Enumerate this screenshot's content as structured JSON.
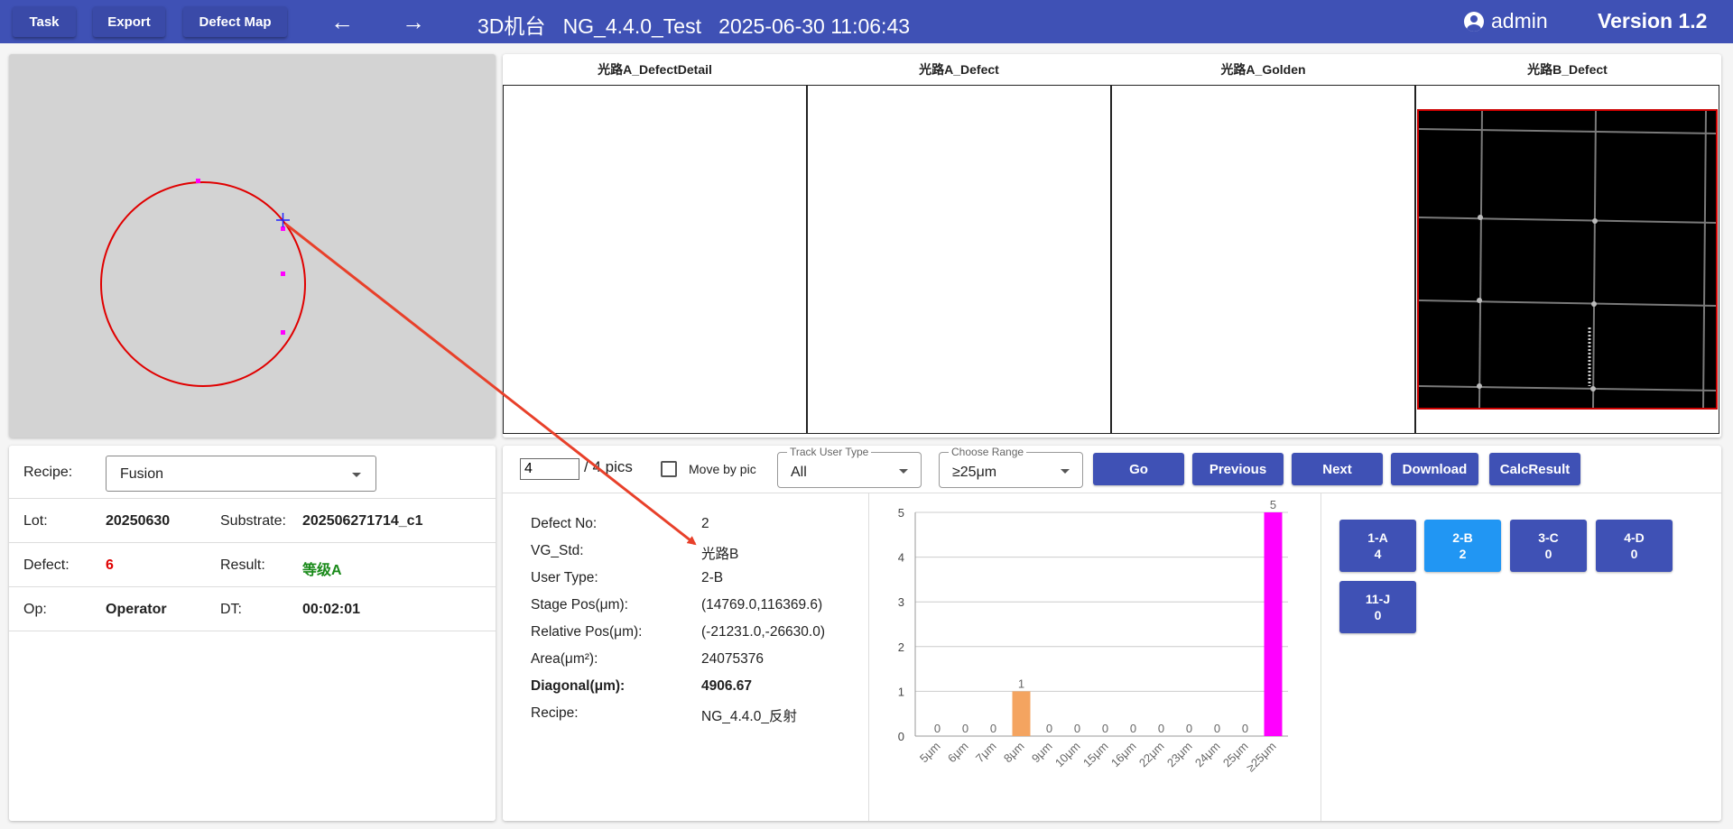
{
  "header": {
    "task_label": "Task",
    "export_label": "Export",
    "defect_map_label": "Defect Map",
    "back_icon": "arrow-left-icon",
    "forward_icon": "arrow-right-icon",
    "title": "3D机台   NG_4.4.0_Test   2025-06-30 11:06:43",
    "username": "admin",
    "version": "Version 1.2"
  },
  "images": {
    "col1_label": "光路A_DefectDetail",
    "col2_label": "光路A_Defect",
    "col3_label": "光路A_Golden",
    "col4_label": "光路B_Defect"
  },
  "info": {
    "recipe_label": "Recipe:",
    "recipe_value": "Fusion",
    "lot_label": "Lot:",
    "lot_value": "20250630",
    "substrate_label": "Substrate:",
    "substrate_value": "202506271714_c1",
    "defect_label": "Defect:",
    "defect_value": "6",
    "result_label": "Result:",
    "result_value": "等级A",
    "op_label": "Op:",
    "op_value": "Operator",
    "dt_label": "DT:",
    "dt_value": "00:02:01"
  },
  "controls": {
    "pic_value": "4",
    "pic_total": "/ 4 pics",
    "move_by_pic_label": "Move by pic",
    "track_user_type_legend": "Track User Type",
    "track_user_type_value": "All",
    "choose_range_legend": "Choose Range",
    "choose_range_value": "≥25μm",
    "go_label": "Go",
    "previous_label": "Previous",
    "next_label": "Next",
    "download_label": "Download",
    "calc_result_label": "CalcResult"
  },
  "detail": {
    "defect_no_label": "Defect No:",
    "defect_no_value": "2",
    "vg_std_label": "VG_Std:",
    "vg_std_value": "光路B",
    "user_type_label": "User Type:",
    "user_type_value": "2-B",
    "stage_pos_label": "Stage Pos(μm):",
    "stage_pos_value": "(14769.0,116369.6)",
    "relative_pos_label": "Relative Pos(μm):",
    "relative_pos_value": "(-21231.0,-26630.0)",
    "area_label": "Area(μm²):",
    "area_value": "24075376",
    "diagonal_label": "Diagonal(μm):",
    "diagonal_value": "4906.67",
    "recipe_label": "Recipe:",
    "recipe_value": "NG_4.4.0_反射"
  },
  "categories": [
    {
      "name": "1-A",
      "count": "4",
      "active": false
    },
    {
      "name": "2-B",
      "count": "2",
      "active": true
    },
    {
      "name": "3-C",
      "count": "0",
      "active": false
    },
    {
      "name": "4-D",
      "count": "0",
      "active": false
    },
    {
      "name": "11-J",
      "count": "0",
      "active": false
    }
  ],
  "colors": {
    "header": "#3f51b5",
    "active_category": "#2196f3",
    "defect_red": "#e00000",
    "result_green": "#1a8a1a",
    "bar_orange": "#f4a460",
    "bar_magenta": "#ff00ff"
  },
  "chart_data": {
    "type": "bar",
    "categories": [
      "5μm",
      "6μm",
      "7μm",
      "8μm",
      "9μm",
      "10μm",
      "15μm",
      "16μm",
      "22μm",
      "23μm",
      "24μm",
      "25μm",
      "≥25μm"
    ],
    "values": [
      0,
      0,
      0,
      1,
      0,
      0,
      0,
      0,
      0,
      0,
      0,
      0,
      5
    ],
    "bar_colors": {
      "8μm": "#f4a460",
      "≥25μm": "#ff00ff"
    },
    "ylim": [
      0,
      5
    ],
    "yticks": [
      0,
      1,
      2,
      3,
      4,
      5
    ],
    "grid": true,
    "data_labels": true
  }
}
